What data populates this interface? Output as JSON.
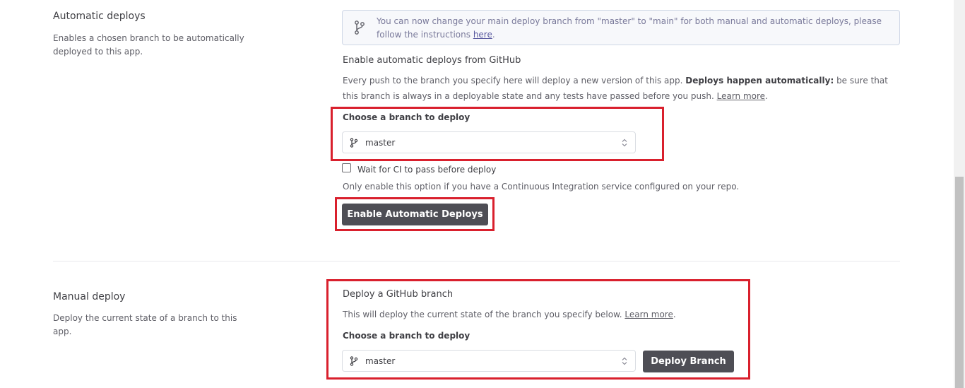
{
  "automatic": {
    "title": "Automatic deploys",
    "description": "Enables a chosen branch to be automatically deployed to this app.",
    "notice_text": "You can now change your main deploy branch from \"master\" to \"main\" for both manual and automatic deploys, please follow the instructions ",
    "notice_link": "here",
    "notice_tail": ".",
    "enable_heading": "Enable automatic deploys from GitHub",
    "info_text": "Every push to the branch you specify here will deploy a new version of this app. ",
    "info_bold": "Deploys happen automatically:",
    "info_text2": " be sure that this branch is always in a deployable state and any tests have passed before you push. ",
    "info_link": "Learn more",
    "info_tail": ".",
    "choose_label": "Choose a branch to deploy",
    "branch_value": "master",
    "ci_label": "Wait for CI to pass before deploy",
    "ci_checked": false,
    "ci_help": "Only enable this option if you have a Continuous Integration service configured on your repo.",
    "enable_button": "Enable Automatic Deploys"
  },
  "manual": {
    "title": "Manual deploy",
    "description": "Deploy the current state of a branch to this app.",
    "heading": "Deploy a GitHub branch",
    "info_text": "This will deploy the current state of the branch you specify below. ",
    "info_link": "Learn more",
    "info_tail": ".",
    "choose_label": "Choose a branch to deploy",
    "branch_value": "master",
    "deploy_button": "Deploy Branch"
  },
  "icons": {
    "branch": "git-branch-icon",
    "select_arrows": "select-arrows-icon"
  },
  "colors": {
    "highlight": "#d9202d",
    "button": "#4e4e55"
  }
}
